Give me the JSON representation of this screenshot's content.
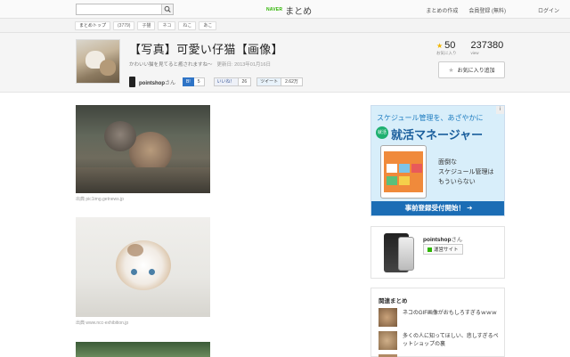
{
  "topbar": {
    "search_placeholder": "",
    "logo_brand": "NAVER",
    "logo_name": "まとめ",
    "links": [
      "まとめの作成",
      "会員登録 (無料)"
    ],
    "login": "ログイン"
  },
  "breadcrumb": {
    "home": "まとめトップ",
    "tags": [
      "(3779)",
      "子猫",
      "ネコ",
      "ねこ",
      "あこ"
    ]
  },
  "article": {
    "title": "【写真】可愛い仔猫【画像】",
    "description": "かわいい猫を見てると癒されますね〜",
    "updated": "更新日: 2013年01月16日",
    "author": "pointshop",
    "author_suffix": "さん",
    "share": {
      "hatena_label": "B!",
      "hatena_count": "5",
      "like_label": "いいね！",
      "like_count": "26",
      "tweet_label": "ツイート",
      "tweet_count": "2.62万"
    }
  },
  "stats": {
    "favorites": "50",
    "favorites_label": "お気に入り",
    "views": "237380",
    "views_label": "view",
    "fav_button": "お気に入り追加"
  },
  "images": [
    {
      "caption": "出典 pic1img.getnews.jp"
    },
    {
      "caption": "出典 www.ncc-exhibition.jp"
    }
  ],
  "ad": {
    "line1": "スケジュール管理を、あざやかに",
    "line2": "就活マネージャー",
    "mark": "就活",
    "body": [
      "面倒な",
      "スケジュール管理は",
      "もういらない"
    ],
    "cta": "事前登録受付開始！ ➔",
    "corner": "i"
  },
  "author_box": {
    "name": "pointshop",
    "suffix": "さん",
    "site": "運営サイト"
  },
  "related": {
    "heading": "関連まとめ",
    "items": [
      "ネコのGIF画像がおもしろすぎるｗｗｗ",
      "多くの人に知ってほしい、悲しすぎるペットショップの裏"
    ]
  }
}
